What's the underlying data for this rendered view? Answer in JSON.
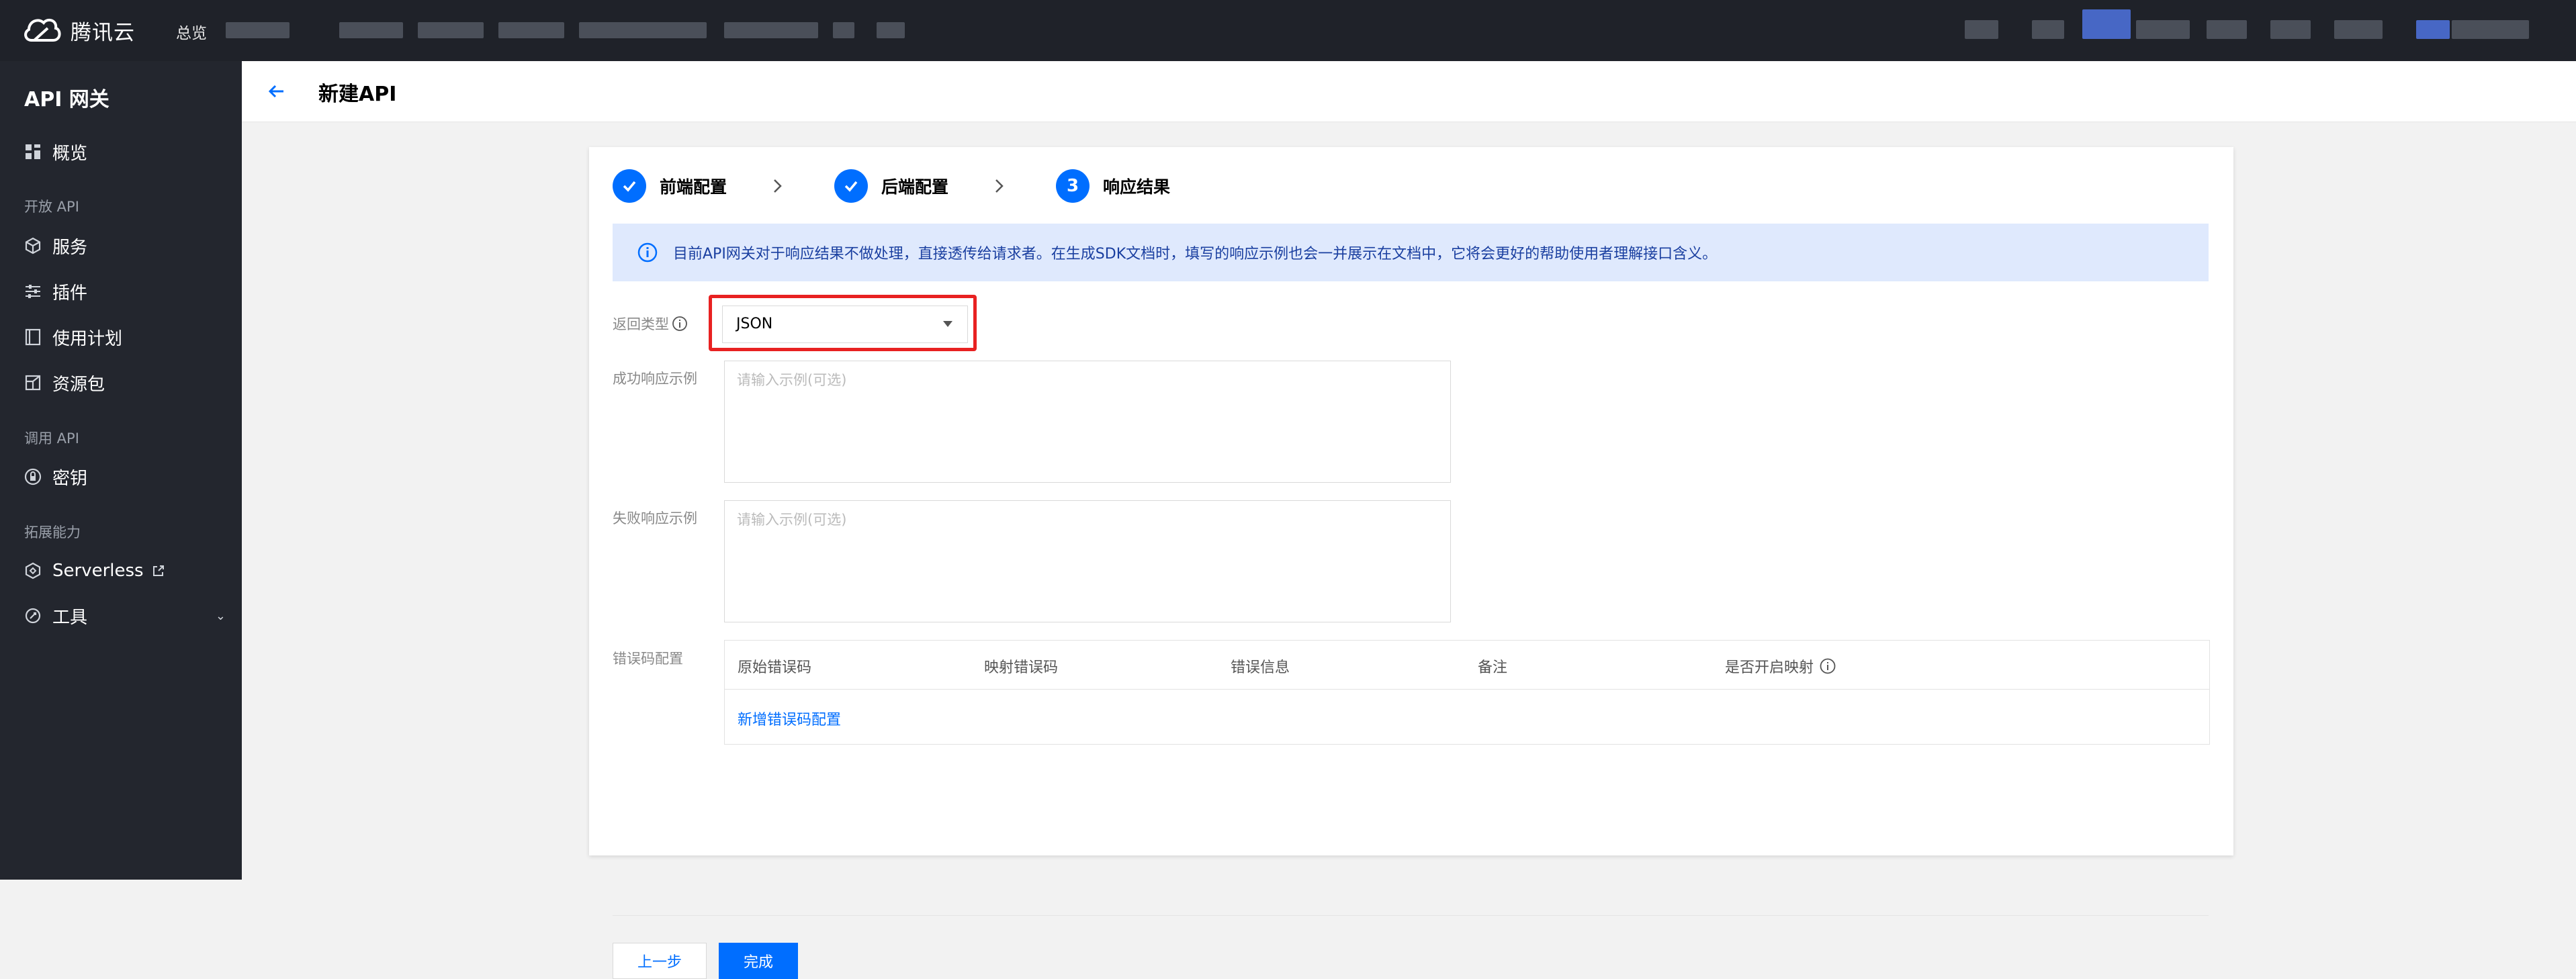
{
  "topbar": {
    "brand": "腾讯云",
    "overview": "总览",
    "logo_icon": "cloud-logo-icon"
  },
  "sidebar": {
    "product_title": "API 网关",
    "items": [
      {
        "label": "概览",
        "icon": "dashboard-icon"
      },
      {
        "label": "服务",
        "icon": "service-cube-icon"
      },
      {
        "label": "插件",
        "icon": "plugin-sliders-icon"
      },
      {
        "label": "使用计划",
        "icon": "plan-book-icon"
      },
      {
        "label": "资源包",
        "icon": "resource-package-icon"
      },
      {
        "label": "密钥",
        "icon": "key-lock-icon"
      },
      {
        "label": "Serverless",
        "icon": "serverless-icon",
        "external_icon": "external-link-icon"
      },
      {
        "label": "工具",
        "icon": "tools-icon",
        "expand_icon": "chevron-down-icon"
      }
    ],
    "groups": [
      "开放 API",
      "调用 API",
      "拓展能力"
    ]
  },
  "header": {
    "title": "新建API",
    "back_icon": "arrow-left-icon"
  },
  "steps": [
    {
      "number": "1",
      "label": "前端配置",
      "state": "done"
    },
    {
      "number": "2",
      "label": "后端配置",
      "state": "done"
    },
    {
      "number": "3",
      "label": "响应结果",
      "state": "active"
    }
  ],
  "alert": {
    "text": "目前API网关对于响应结果不做处理，直接透传给请求者。在生成SDK文档时，填写的响应示例也会一并展示在文档中，它将会更好的帮助使用者理解接口含义。"
  },
  "form": {
    "return_type_label": "返回类型",
    "return_type_value": "JSON",
    "success_label": "成功响应示例",
    "success_placeholder": "请输入示例(可选)",
    "failure_label": "失败响应示例",
    "failure_placeholder": "请输入示例(可选)",
    "error_code_label": "错误码配置"
  },
  "error_table": {
    "columns": [
      "原始错误码",
      "映射错误码",
      "错误信息",
      "备注",
      "是否开启映射"
    ],
    "add_link": "新增错误码配置"
  },
  "actions": {
    "prev": "上一步",
    "done": "完成"
  },
  "colors": {
    "accent": "#006eff",
    "topbar_bg": "#1f2229",
    "sidebar_bg": "#23262e",
    "alert_bg": "#dfe9fd",
    "highlight": "#e82121"
  }
}
